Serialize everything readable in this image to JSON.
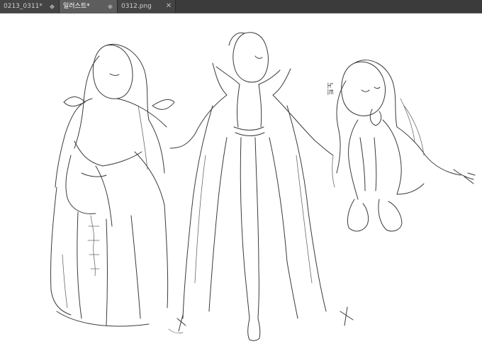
{
  "tabs": [
    {
      "label": "0213_0311*",
      "active": false
    },
    {
      "label": "일러스트*",
      "active": true
    },
    {
      "label": "0312.png",
      "active": false
    }
  ],
  "canvas": {
    "annotation": "노트"
  },
  "colors": {
    "tabbar_bg": "#3b3b3b",
    "tab_active_bg": "#5d5d5d",
    "canvas_bg": "#ffffff",
    "sketch_stroke": "#3a3a3a"
  },
  "icons": {
    "tab_close": "close-icon",
    "tab_modified": "diamond-icon"
  }
}
